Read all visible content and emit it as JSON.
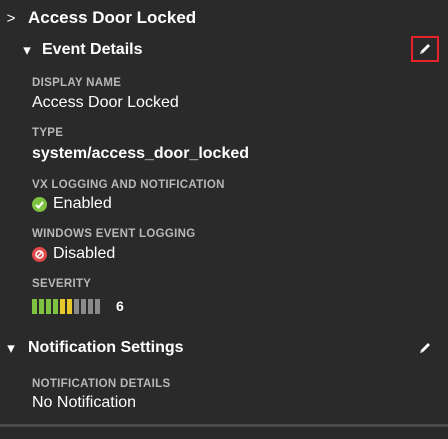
{
  "header": {
    "chevron": ">",
    "title": "Access Door Locked"
  },
  "event_details": {
    "chevron": "▾",
    "title": "Event Details",
    "display_name_label": "DISPLAY NAME",
    "display_name_value": "Access Door Locked",
    "type_label": "TYPE",
    "type_value": "system/access_door_locked",
    "vx_logging_label": "VX LOGGING AND NOTIFICATION",
    "vx_logging_value": "Enabled",
    "windows_logging_label": "WINDOWS EVENT LOGGING",
    "windows_logging_value": "Disabled",
    "severity_label": "SEVERITY",
    "severity_value": "6",
    "severity_level": 6,
    "severity_max": 10
  },
  "notification_settings": {
    "chevron": "▾",
    "title": "Notification Settings",
    "details_label": "NOTIFICATION DETAILS",
    "details_value": "No Notification"
  },
  "icons": {
    "edit_event_details": "pencil-icon",
    "edit_notification": "pencil-icon",
    "enabled": "check-circle-icon",
    "disabled": "no-entry-icon"
  },
  "colors": {
    "background": "#2a2a2a",
    "highlight": "#e8232e",
    "enabled": "#7ec242",
    "disabled": "#e04a4a",
    "severity_low": "#7ec242",
    "severity_mid": "#e8c82a",
    "severity_empty": "#8a8a8a"
  }
}
